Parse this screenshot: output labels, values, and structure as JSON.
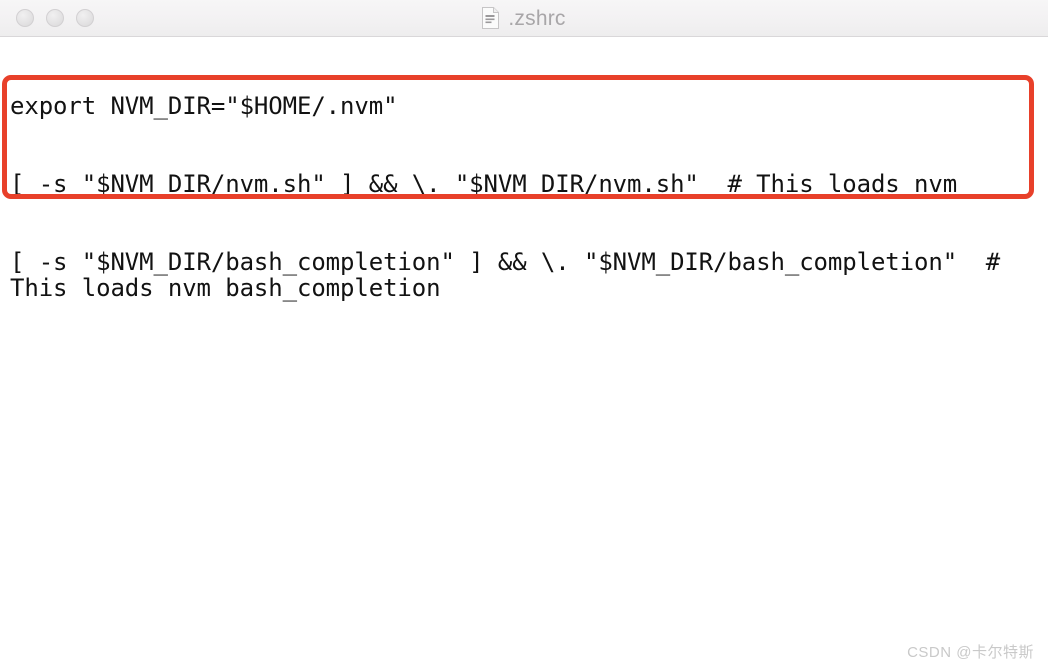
{
  "window": {
    "title": ".zshrc",
    "icon": "document-icon",
    "traffic_lights": [
      {
        "name": "close",
        "label": "Close",
        "color": "#e4e3e4"
      },
      {
        "name": "minimize",
        "label": "Minimize",
        "color": "#e4e3e4"
      },
      {
        "name": "zoom",
        "label": "Zoom",
        "color": "#e4e3e4"
      }
    ]
  },
  "document": {
    "lines": [
      "export NVM_DIR=\"$HOME/.nvm\"",
      "[ -s \"$NVM_DIR/nvm.sh\" ] && \\. \"$NVM_DIR/nvm.sh\"  # This loads nvm",
      "[ -s \"$NVM_DIR/bash_completion\" ] && \\. \"$NVM_DIR/bash_completion\"  # This loads nvm bash_completion"
    ]
  },
  "annotation": {
    "shape": "rounded-rectangle",
    "color": "#e8402a",
    "border_width_px": 5
  },
  "watermark": {
    "text": "CSDN @卡尔特斯",
    "color": "#c9c9c9"
  }
}
